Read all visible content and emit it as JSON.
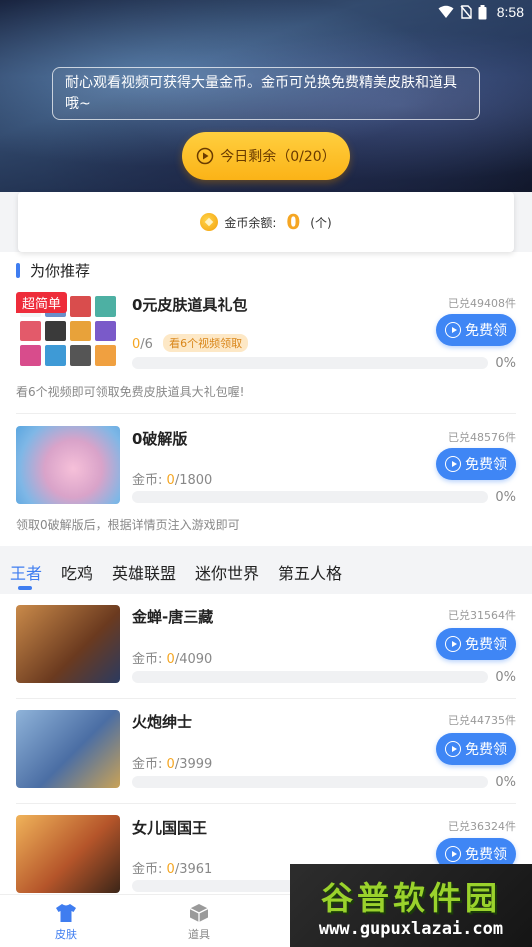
{
  "status_bar": {
    "time": "8:58"
  },
  "header": {
    "notice": "耐心观看视频可获得大量金币。金币可兑换免费精美皮肤和道具哦~",
    "watch_button": "今日剩余（0/20）"
  },
  "balance": {
    "label": "金币余额:",
    "value": "0",
    "unit": "(个)"
  },
  "recommend": {
    "title": "为你推荐",
    "items": [
      {
        "badge": "超简单",
        "title": "0元皮肤道具礼包",
        "redeemed": "已兑49408件",
        "progress_current": "0",
        "progress_total": "/6",
        "tag": "看6个视频领取",
        "percent": "0%",
        "button": "免费领",
        "hint": "看6个视频即可领取免费皮肤道具大礼包喔!"
      },
      {
        "title": "0破解版",
        "redeemed": "已兑48576件",
        "progress_label": "金币:",
        "progress_current": "0",
        "progress_total": "/1800",
        "percent": "0%",
        "button": "免费领",
        "hint": "领取0破解版后，根据详情页注入游戏即可"
      }
    ]
  },
  "tabs": [
    "王者",
    "吃鸡",
    "英雄联盟",
    "迷你世界",
    "第五人格"
  ],
  "skins": [
    {
      "title": "金蝉-唐三藏",
      "redeemed": "已兑31564件",
      "progress_label": "金币:",
      "progress_current": "0",
      "progress_total": "/4090",
      "percent": "0%",
      "button": "免费领"
    },
    {
      "title": "火炮绅士",
      "redeemed": "已兑44735件",
      "progress_label": "金币:",
      "progress_current": "0",
      "progress_total": "/3999",
      "percent": "0%",
      "button": "免费领"
    },
    {
      "title": "女儿国国王",
      "redeemed": "已兑36324件",
      "progress_label": "金币:",
      "progress_current": "0",
      "progress_total": "/3961",
      "button": "免费领"
    }
  ],
  "bottom_nav": [
    {
      "label": "皮肤",
      "icon": "tshirt-icon",
      "active": true
    },
    {
      "label": "道具",
      "icon": "box-icon",
      "active": false
    }
  ],
  "watermark": {
    "title": "谷普软件园",
    "url": "www.gupuxlazai.com"
  },
  "colors": {
    "accent": "#3f7df0",
    "coin": "#f5a623",
    "badge": "#ee2c3a",
    "button": "#3f86f5"
  }
}
